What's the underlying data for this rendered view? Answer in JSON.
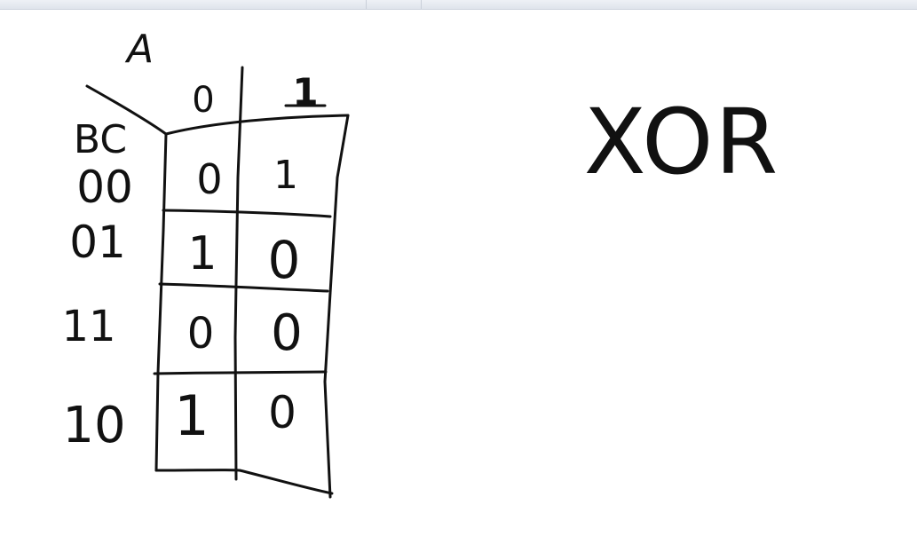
{
  "diagram": {
    "type": "karnaugh-map",
    "column_variable": "A",
    "row_variable": "BC",
    "column_headers": [
      "0",
      "1"
    ],
    "row_headers": [
      "00",
      "01",
      "11",
      "10"
    ],
    "cells": [
      [
        "0",
        "1"
      ],
      [
        "1",
        "0"
      ],
      [
        "0",
        "0"
      ],
      [
        "1",
        "0"
      ]
    ],
    "note": "XOR"
  },
  "colors": {
    "ink": "#111111",
    "background": "#ffffff",
    "toolbar": "#dfe4ec"
  }
}
